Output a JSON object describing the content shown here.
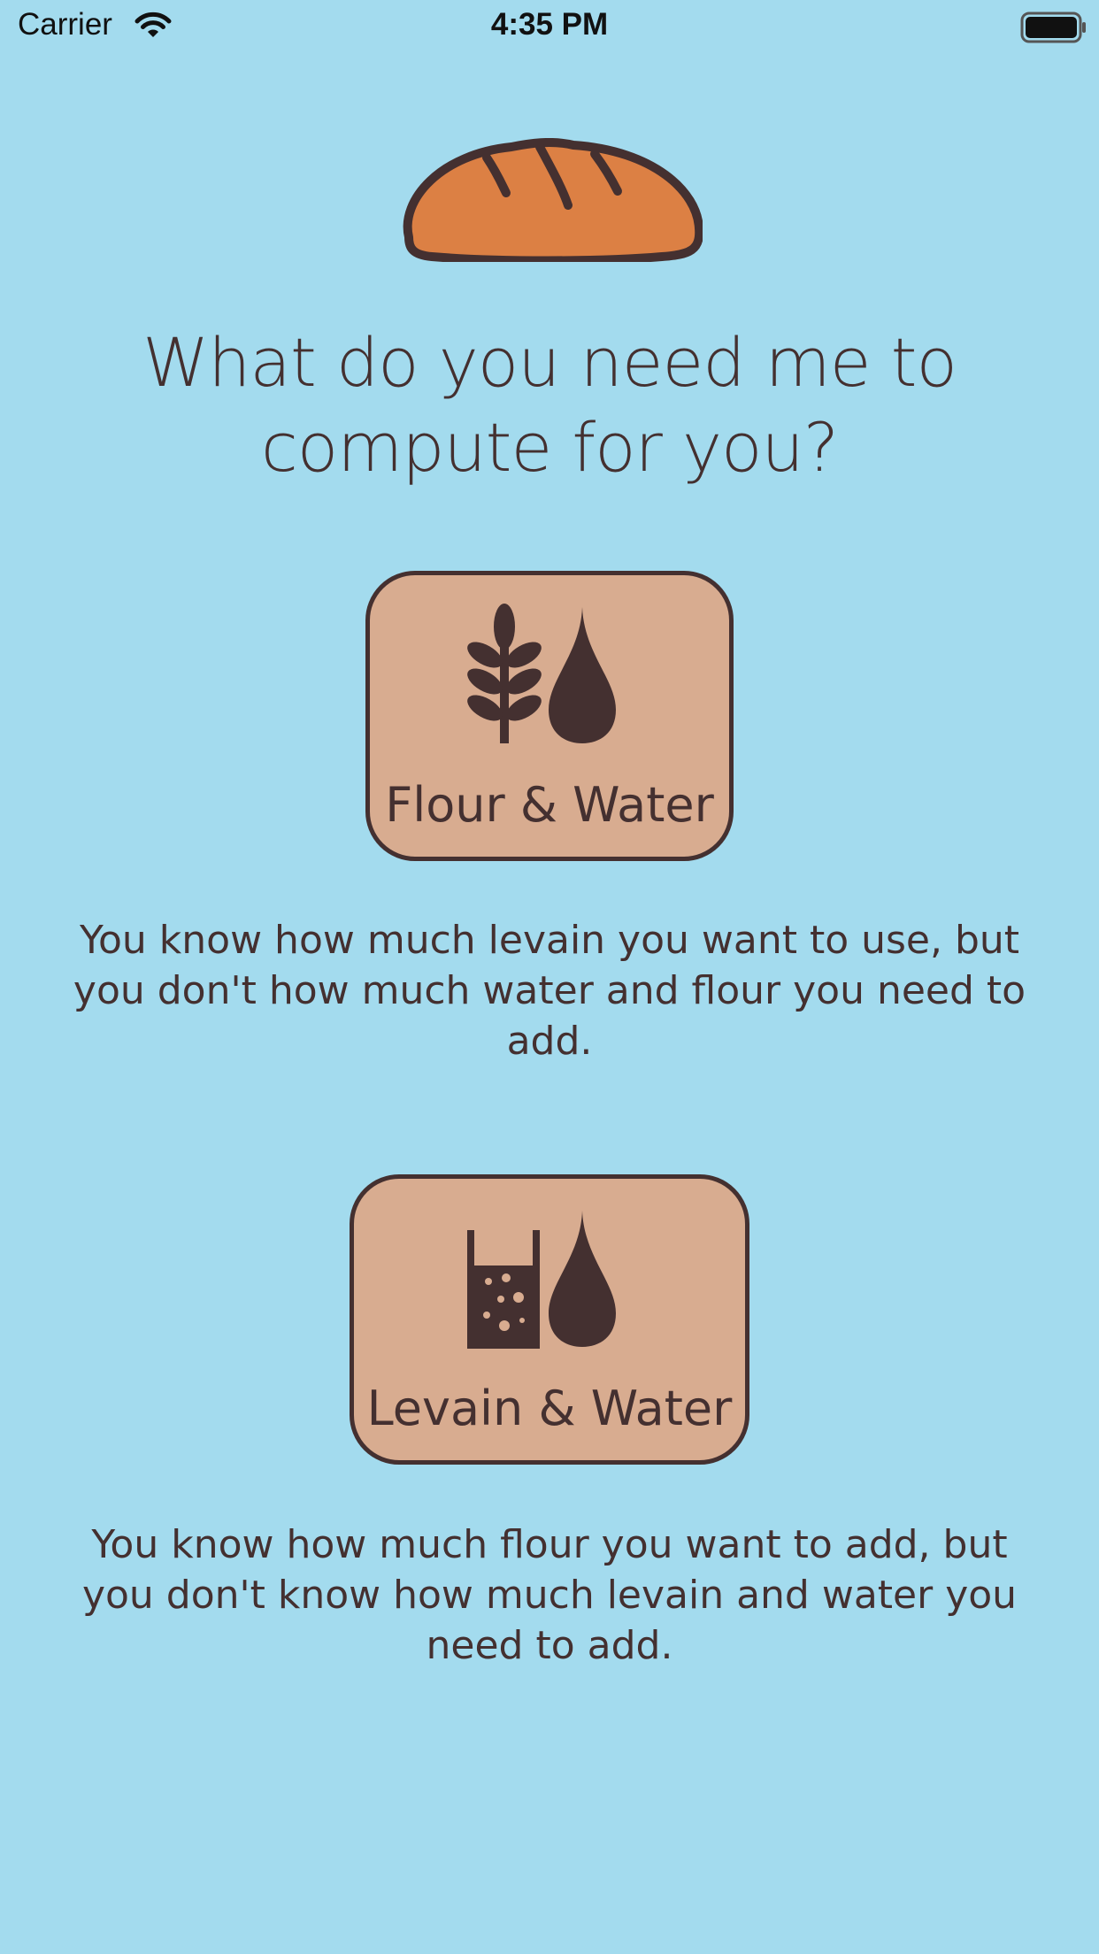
{
  "status_bar": {
    "carrier": "Carrier",
    "time": "4:35 PM",
    "wifi_icon": "wifi-icon",
    "battery_icon": "battery-full-icon"
  },
  "logo": {
    "icon": "bread-loaf-icon",
    "fill_color": "#dc8044",
    "stroke_color": "#443030"
  },
  "question": {
    "line1": "What do you need me to",
    "line2": "compute for you?"
  },
  "options": [
    {
      "label": "Flour & Water",
      "icons": [
        "wheat-icon",
        "water-drop-icon"
      ],
      "description": "You know how much levain you want to use, but you don't how much water and flour you need to add."
    },
    {
      "label": "Levain & Water",
      "icons": [
        "levain-jar-icon",
        "water-drop-icon"
      ],
      "description": "You know how much flour you want to add, but you don't know how much levain and water you need to add."
    }
  ],
  "colors": {
    "background": "#a3dbee",
    "card": "#d8ac90",
    "ink": "#443030"
  }
}
